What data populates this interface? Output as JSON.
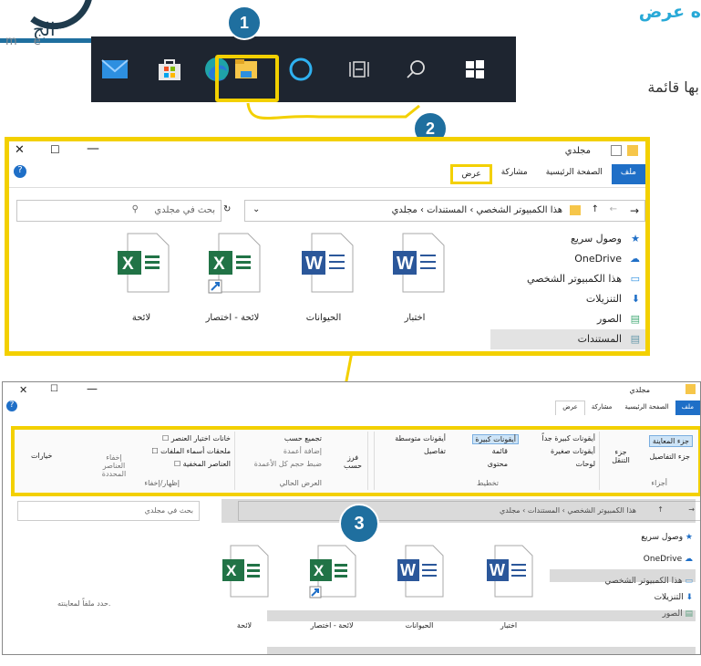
{
  "logo": {
    "text_ar": "الج",
    "text_latin": "m e"
  },
  "heading": "ه عرض",
  "side_text": "بها قائمة",
  "badges": [
    "1",
    "2",
    "3"
  ],
  "taskbar": {
    "icons": [
      "mail-icon",
      "store-icon",
      "edge-icon",
      "file-explorer-icon",
      "cortana-icon",
      "task-view-icon",
      "search-icon",
      "windows-icon"
    ]
  },
  "explorer1": {
    "title": "مجلدي",
    "menu": [
      "ملف",
      "الصفحة الرئيسية",
      "مشاركة",
      "عرض"
    ],
    "address": [
      "هذا الكمبيوتر الشخصي",
      "المستندات",
      "مجلدي"
    ],
    "search_placeholder": "بحث في مجلدي",
    "nav": [
      "وصول سريع",
      "OneDrive",
      "هذا الكمبيوتر الشخصي",
      "التنزيلات",
      "الصور",
      "المستندات"
    ],
    "files": [
      {
        "name": "اختبار",
        "type": "word"
      },
      {
        "name": "الحيوانات",
        "type": "word"
      },
      {
        "name": "لائحة - اختصار",
        "type": "excel"
      },
      {
        "name": "لائحة",
        "type": "excel"
      }
    ]
  },
  "explorer2": {
    "title": "مجلدي",
    "menu": [
      "ملف",
      "الصفحة الرئيسية",
      "مشاركة",
      "عرض"
    ],
    "ribbon": {
      "panes": {
        "label": "أجزاء",
        "items": [
          "جزء المعاينة",
          "جزء التفاصيل",
          "جزء التنقل"
        ]
      },
      "layout": {
        "label": "تخطيط",
        "items": [
          "أيقونات كبيرة جداً",
          "أيقونات كبيرة",
          "أيقونات متوسطة",
          "أيقونات صغيرة",
          "قائمة",
          "تفاصيل",
          "لوحات",
          "محتوى"
        ]
      },
      "current_view": {
        "label": "العرض الحالي",
        "items": [
          "فرز حسب",
          "تجميع حسب",
          "إضافة أعمدة",
          "ضبط حجم كل الأعمدة"
        ]
      },
      "show_hide": {
        "label": "إظهار/إخفاء",
        "items": [
          "خانات اختيار العنصر",
          "ملحقات أسماء الملفات",
          "العناصر المخفية",
          "إخفاء العناصر المحددة"
        ]
      },
      "options": "خيارات"
    },
    "address": [
      "هذا الكمبيوتر الشخصي",
      "المستندات",
      "مجلدي"
    ],
    "search_placeholder": "بحث في مجلدي",
    "nav": [
      "وصول سريع",
      "OneDrive",
      "هذا الكمبيوتر الشخصي",
      "التنزيلات",
      "الصور"
    ],
    "files": [
      {
        "name": "اختبار",
        "type": "word"
      },
      {
        "name": "الحيوانات",
        "type": "word"
      },
      {
        "name": "لائحة - اختصار",
        "type": "excel"
      },
      {
        "name": "لائحة",
        "type": "excel"
      }
    ],
    "preview_text": "حدد ملفاً لمعاينته."
  },
  "colors": {
    "highlight": "#f3d000",
    "badge": "#1f6f9f",
    "taskbar": "#1e2530",
    "word": "#2b579a",
    "excel": "#217346",
    "file_tab": "#1f6fc7"
  }
}
